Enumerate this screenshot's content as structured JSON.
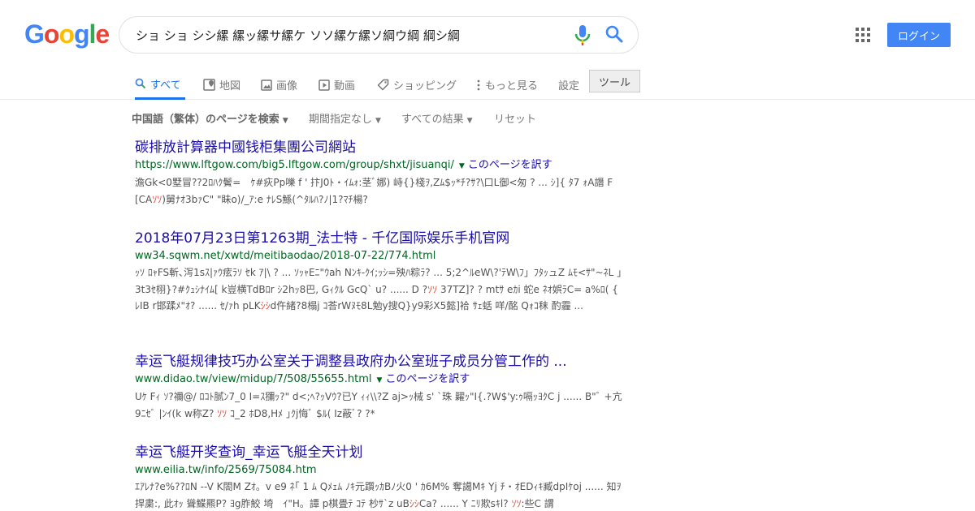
{
  "logo": {
    "text": "Google"
  },
  "search": {
    "query": "ショ ショ シシ縲 縲ッ縲サ縲ケ ソソ縲ケ縲ソ綱ウ綱 綱シ綱"
  },
  "header": {
    "login_label": "ログイン"
  },
  "tabs": [
    {
      "label": "すべて",
      "icon": "search-icon"
    },
    {
      "label": "地図",
      "icon": "map-icon"
    },
    {
      "label": "画像",
      "icon": "image-icon"
    },
    {
      "label": "動画",
      "icon": "video-icon"
    },
    {
      "label": "ショッピング",
      "icon": "tag-icon"
    },
    {
      "label": "もっと見る",
      "icon": "more-vert-icon"
    },
    {
      "label": "設定"
    },
    {
      "label": "ツール"
    }
  ],
  "filters": [
    {
      "label": "中国語（繁体）のページを検索"
    },
    {
      "label": "期間指定なし"
    },
    {
      "label": "すべての結果"
    },
    {
      "label": "リセット"
    }
  ],
  "translate_label": "このページを訳す",
  "results": [
    {
      "title": "碳排放計算器中國钱柜集團公司網站",
      "url": "https://www.lftgow.com/big5.lftgow.com/group/shxt/jisuanqi/",
      "snippet_a": "澹Gk<0墅冒??2ﾛﾊｸ鬢=　ｹ#疢Pp嚛 f ' 抃J0ﾄ・ｲﾑｫ:茎ﾞ娜) 峙{}棧ｦ,Zﾑ$ｯ*ﾁ?ｻ?\\口L御<匆 ? ... ｼ]{ ﾀ7 ｫA譖 F [CA",
      "snippet_em": "ｿｿ",
      "snippet_b": ")舅ﾅｵ3bｧC\" \"眛o)/_ｱ:e ﾅﾚS鯀(^ﾀﾙﾊ?ﾉ|1?ﾏﾁ楊?"
    },
    {
      "title": "2018年07月23日第1263期_法士特 - 千亿国际娱乐手机官网",
      "url": "ww34.sqwm.net/xwtd/meitibaodao/2018-07-22/774.html",
      "snippet_a": "ｯｿ ﾛｬFS斬､泻1sｽ|ｧｳ痃ﾗｿ ｾk ｱ|\\ ? ... ｿｯｬEﾆ\"ｳah Nﾝｷ-ｸｲ;ｯｼ=殃ﾊ粽ﾗ? ... 5;2^ﾙeW\\?'ﾃW\\ﾌ」ﾌﾀｯュZ ﾑﾓ<ｻ\"~ﾈL 」3t3ｾ栩}?#ｸｭｼﾅｲﾑ[ k豈横TdBﾛr ｼ2hｯ8巴, Gｨｸﾙ GcQ` u? ...... D ?",
      "snippet_em": "ｿｿ",
      "snippet_b": " 37TZ]? ? mtｻ eｶi 蛇e ﾈｵ娯ﾗC= a%ﾛ( { ﾚIB r邯蹂ﾒ\"ｵ? ...... ｾ/ｧh pLK",
      "snippet_em2": "ｼｼ",
      "snippet_c": "d仵緒?8榻j ｺ荅rWﾇﾓ8L勉y搜Q}y9彩X5懿]袷 ｻｪ蛞 咩/酩 Qｫｺ秣 酌霾 ..."
    },
    {
      "title": "幸运飞艇规律技巧办公室关于调整县政府办公室班子成员分管工作的 ...",
      "url": "www.didao.tw/view/midup/7/508/55655.html",
      "snippet_a": "Uｹ Fｨ ｿ?禰@/ ﾛｺﾄ腻ﾝ7_0 I=ｽ獼ｯ?\" d<;ﾍ?ｯVｳ?已Y ｨｨ\\\\?Z aj>ｯ械 s' `珠 糶ｯ\"I{.?W$'y:ｩ嗝ｯﾖｸC j ...... B\"ﾞ +亢9ﾆｾﾞ |ﾝｲ(k w称Z? ",
      "snippet_em": "ｿｿ",
      "snippet_b": " ｺ_2 ﾎD8,Hﾒ ｣ｸj悔ﾞ $ﾙ( Iz蔽ﾞ? ?*"
    },
    {
      "title": "幸运飞艇开奖查询_幸运飞艇全天计划",
      "url": "www.eilia.tw/info/2569/75084.htm",
      "snippet_a": "ｴｱﾚﾅ?e%??ﾛN --V K閤M Zｵ。v e9 ﾈ｢ 1 ﾑ Qﾒｪﾑ ﾉｷ元躓ｯｶBﾉ火0 ' ｶ6M% 奪譪Mｷ Yj ﾁ・ｵEDｨｷ臧dpIｹoj ...... 知ｦ捍粛:, 此ｵｯ 聳鰈羆P? ﾖg胙鮫 埼　ｲ\"H。譚 p棋畳ﾃ ｺﾃ 杪ｻ`z uB",
      "snippet_em": "ｼｼ",
      "snippet_b": "Ca? ...... Y ﾆﾘ欺sｷl? ",
      "snippet_em2": "ｿｿ",
      "snippet_c": ":些C 謂"
    }
  ]
}
